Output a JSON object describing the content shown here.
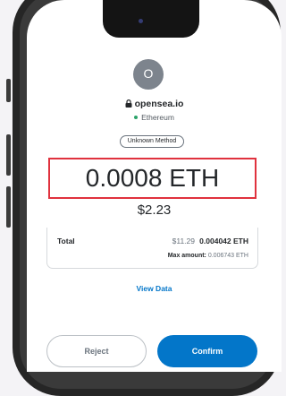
{
  "dapp": {
    "avatar_letter": "O",
    "site": "opensea.io",
    "network": "Ethereum"
  },
  "transaction": {
    "method_badge": "Unknown Method",
    "amount": "0.0008 ETH",
    "fiat_amount": "$2.23"
  },
  "summary": {
    "total_label": "Total",
    "total_fiat": "$11.29",
    "total_eth": "0.004042 ETH",
    "max_amount_label": "Max amount:",
    "max_amount_value": "0.006743 ETH"
  },
  "actions": {
    "view_data": "View Data",
    "reject": "Reject",
    "confirm": "Confirm"
  },
  "colors": {
    "primary": "#0376c9",
    "highlight_border": "#e0323e",
    "network_dot": "#2ca36a"
  }
}
